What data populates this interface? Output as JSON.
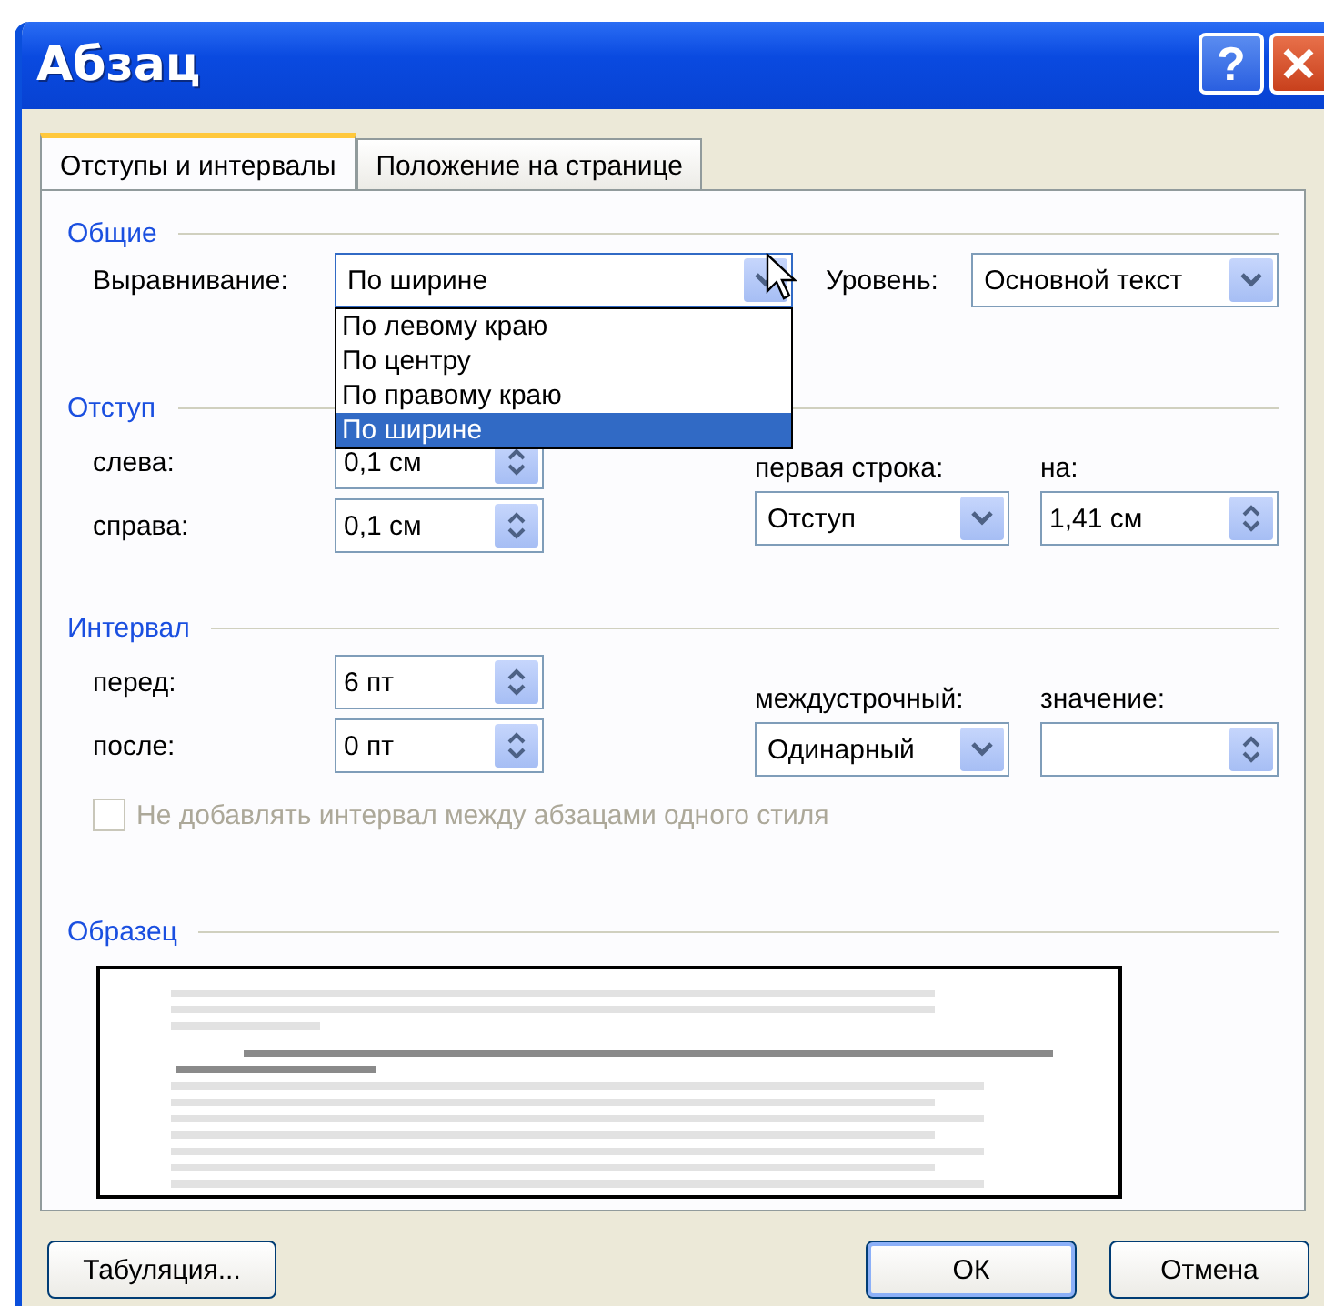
{
  "window": {
    "title": "Абзац"
  },
  "title_buttons": [
    {
      "kind": "help",
      "label": "?"
    },
    {
      "kind": "close"
    }
  ],
  "tabs": [
    {
      "label": "Отступы и интервалы",
      "selected": true
    },
    {
      "label": "Положение на странице",
      "selected": false
    }
  ],
  "general": {
    "heading": "Общие",
    "alignment": {
      "label": "Выравнивание:",
      "value": "По ширине",
      "expanded": true,
      "options": [
        {
          "label": "По левому краю",
          "selected": false
        },
        {
          "label": "По центру",
          "selected": false
        },
        {
          "label": "По правому краю",
          "selected": false
        },
        {
          "label": "По ширине",
          "selected": true
        }
      ]
    },
    "level": {
      "label": "Уровень:",
      "value": "Основной текст"
    }
  },
  "indent": {
    "heading": "Отступ",
    "left": {
      "label": "слева:",
      "value": "0,1 см"
    },
    "right": {
      "label": "справа:",
      "value": "0,1 см"
    },
    "first_line": {
      "label": "первая строка:",
      "value": "Отступ"
    },
    "by": {
      "label": "на:",
      "value": "1,41 см"
    }
  },
  "spacing": {
    "heading": "Интервал",
    "before": {
      "label": "перед:",
      "value": "6 пт"
    },
    "after": {
      "label": "после:",
      "value": "0 пт"
    },
    "line_spacing": {
      "label": "междустрочный:",
      "value": "Одинарный"
    },
    "at": {
      "label": "значение:"
    }
  },
  "checkbox": {
    "label": "Не добавлять интервал между абзацами одного стиля",
    "checked": false,
    "disabled": true
  },
  "sample": {
    "heading": "Образец"
  },
  "buttons": [
    {
      "label": "Табуляция...",
      "default": false
    },
    {
      "label": "ОК",
      "default": true
    },
    {
      "label": "Отмена",
      "default": false
    }
  ]
}
